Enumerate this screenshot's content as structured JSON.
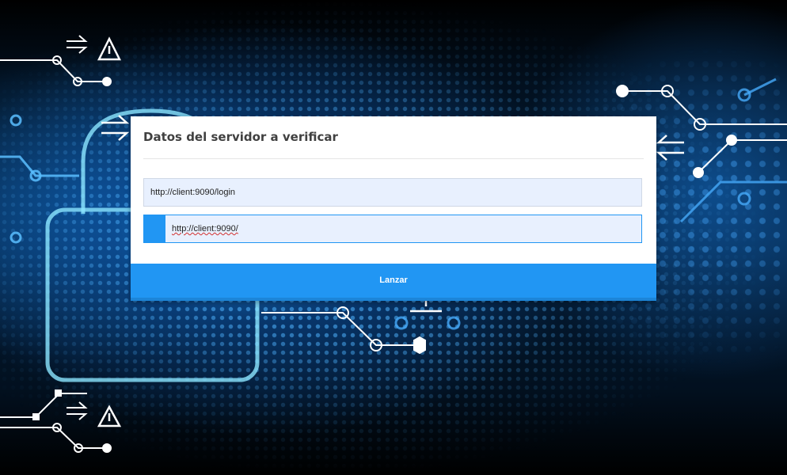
{
  "form": {
    "title": "Datos del servidor a verificar",
    "fields": [
      {
        "value": "http://client:9090/login"
      },
      {
        "value": "http://client:9090/"
      }
    ],
    "submit_label": "Lanzar"
  },
  "colors": {
    "accent": "#2196f3",
    "field_background": "#e8f0fe",
    "title_text": "#404040",
    "background_dark": "#02101f",
    "background_glow": "#1e8ce6"
  },
  "background": {
    "icons": [
      "padlock-icon",
      "circuit-lines",
      "warning-triangle-icon",
      "double-arrow-right-icon",
      "double-arrow-left-icon"
    ]
  }
}
